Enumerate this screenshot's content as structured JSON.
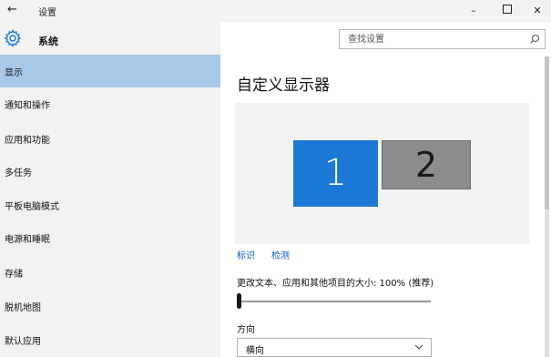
{
  "window": {
    "back_icon": "←",
    "title": "设置",
    "minimize": "–",
    "maximize_icon": "maximize-icon",
    "close": "✕"
  },
  "header": {
    "title": "系统",
    "icon": "gear-icon"
  },
  "search": {
    "placeholder": "查找设置",
    "icon": "search-icon"
  },
  "sidebar": {
    "items": [
      {
        "label": "显示",
        "selected": true
      },
      {
        "label": "通知和操作",
        "selected": false
      },
      {
        "label": "应用和功能",
        "selected": false
      },
      {
        "label": "多任务",
        "selected": false
      },
      {
        "label": "平板电脑模式",
        "selected": false
      },
      {
        "label": "电源和睡眠",
        "selected": false
      },
      {
        "label": "存储",
        "selected": false
      },
      {
        "label": "脱机地图",
        "selected": false
      },
      {
        "label": "默认应用",
        "selected": false
      }
    ],
    "selected_color": "#a9c8e8"
  },
  "main": {
    "title": "自定义显示器",
    "monitors": [
      {
        "number": "1",
        "color": "#1b78d4",
        "selected": true
      },
      {
        "number": "2",
        "color": "#8c8c8c",
        "selected": false
      }
    ],
    "links": {
      "identify": "标识",
      "detect": "检测"
    },
    "scale": {
      "label": "更改文本、应用和其他项目的大小: 100% (推荐)",
      "slider_position": 0
    },
    "orientation": {
      "label": "方向",
      "value": "横向"
    }
  },
  "colors": {
    "accent": "#1b78d4",
    "link": "#0a5cc4",
    "sidebar_bg": "#f2f2f2"
  }
}
